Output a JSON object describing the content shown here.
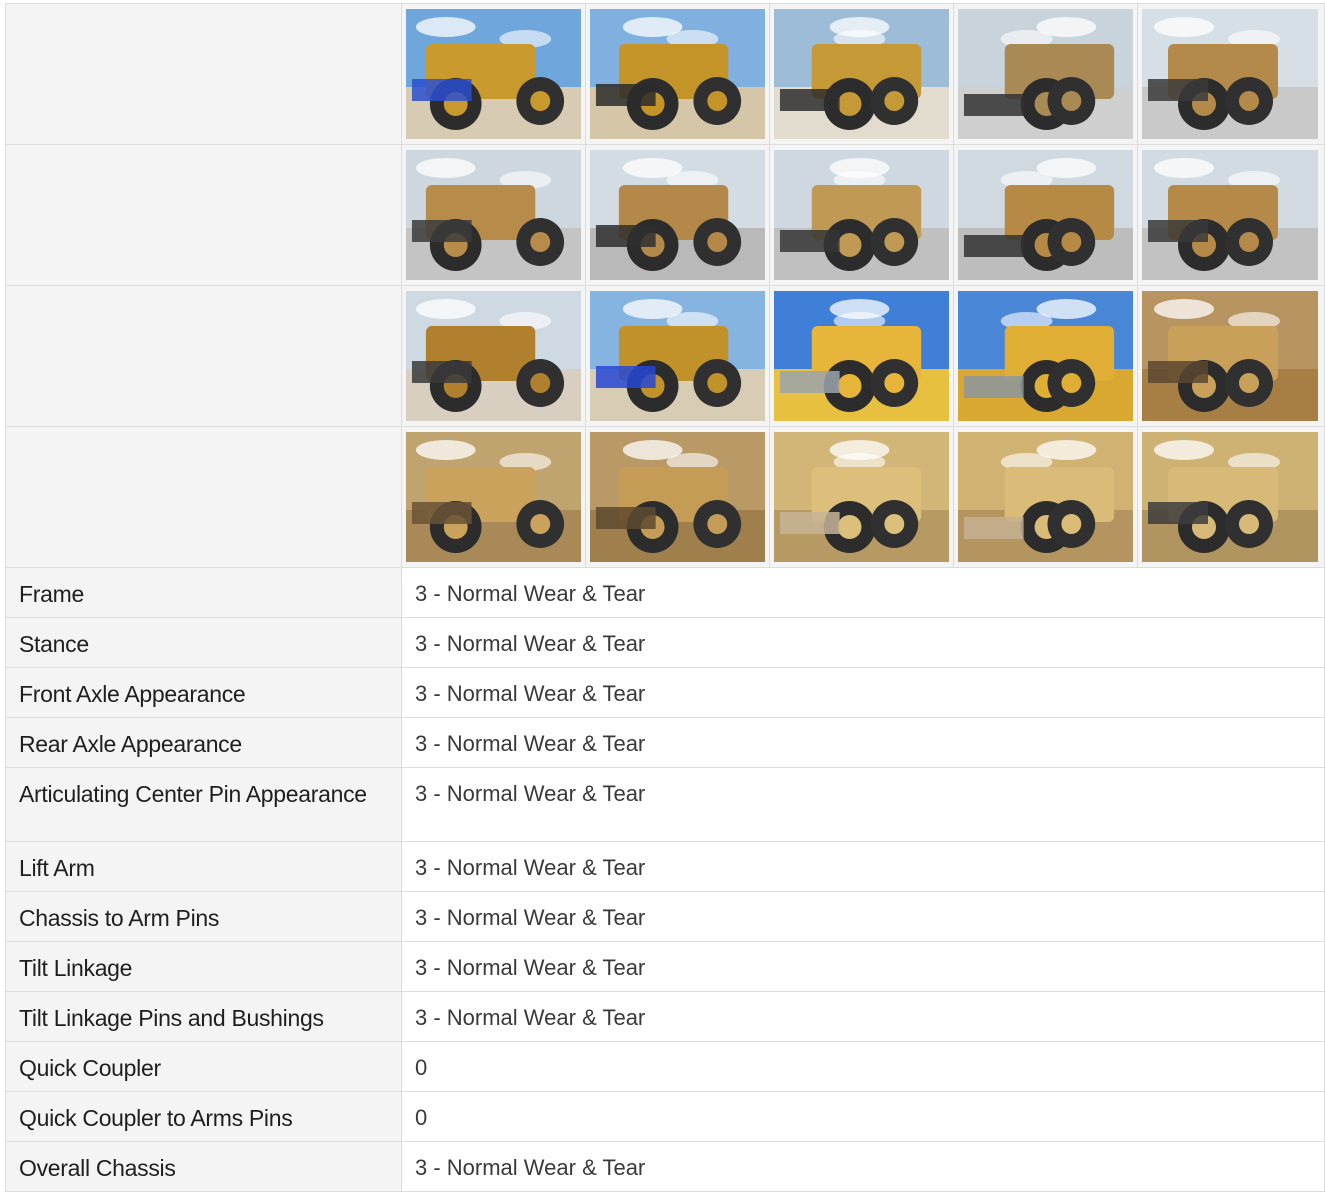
{
  "photo_rows": [
    [
      {
        "name": "photo-loader-front-left",
        "sky": "#6fa6dc",
        "ground": "#d8cbb4",
        "body": "#c89a2e",
        "accent": "#2a4fd0"
      },
      {
        "name": "photo-loader-front-right",
        "sky": "#7fb0df",
        "ground": "#d6c6a8",
        "body": "#c49428",
        "accent": "#2b2b2b"
      },
      {
        "name": "photo-loader-rear",
        "sky": "#9cbcd8",
        "ground": "#e2dccf",
        "body": "#c59a36",
        "accent": "#2e2e2e"
      },
      {
        "name": "photo-underside-axle-1",
        "sky": "#c9d3dc",
        "ground": "#cfcfcf",
        "body": "#a98a55",
        "accent": "#333333"
      },
      {
        "name": "photo-underside-axle-2",
        "sky": "#d6dfe6",
        "ground": "#c9c9c9",
        "body": "#b48a4a",
        "accent": "#3a3a3a"
      }
    ],
    [
      {
        "name": "photo-tire-closeup-1",
        "sky": "#cfd7de",
        "ground": "#c4c4c4",
        "body": "#b78c4a",
        "accent": "#3b3b3b"
      },
      {
        "name": "photo-frame-underside-1",
        "sky": "#d3dce3",
        "ground": "#b9b9b9",
        "body": "#b38848",
        "accent": "#2f2f2f"
      },
      {
        "name": "photo-frame-underside-2",
        "sky": "#cfd8e0",
        "ground": "#c0c0c0",
        "body": "#c09a55",
        "accent": "#353535"
      },
      {
        "name": "photo-tire-closeup-2",
        "sky": "#d0d9e0",
        "ground": "#bdbdbd",
        "body": "#b68a45",
        "accent": "#333333"
      },
      {
        "name": "photo-tire-closeup-3",
        "sky": "#d2dbe2",
        "ground": "#c2c2c2",
        "body": "#b58a48",
        "accent": "#383838"
      }
    ],
    [
      {
        "name": "photo-underside-view",
        "sky": "#cfd9e3",
        "ground": "#d8cfc0",
        "body": "#b0802f",
        "accent": "#3a3a3a"
      },
      {
        "name": "photo-loader-bucket-front",
        "sky": "#86b4e0",
        "ground": "#d9ccb4",
        "body": "#c2922a",
        "accent": "#2648d6"
      },
      {
        "name": "photo-lift-cylinder-1",
        "sky": "#3f7fd8",
        "ground": "#e8c040",
        "body": "#e7b53a",
        "accent": "#9aa3ad"
      },
      {
        "name": "photo-lift-cylinder-2",
        "sky": "#4a86d6",
        "ground": "#d8a830",
        "body": "#e0ad35",
        "accent": "#8d969f"
      },
      {
        "name": "photo-linkage-pin-1",
        "sky": "#b89560",
        "ground": "#a77f45",
        "body": "#c9a05a",
        "accent": "#5a4630"
      }
    ],
    [
      {
        "name": "photo-center-pin-1",
        "sky": "#c0a46f",
        "ground": "#a88957",
        "body": "#caa25b",
        "accent": "#6a5436"
      },
      {
        "name": "photo-center-pin-2",
        "sky": "#b99a66",
        "ground": "#9f7f4c",
        "body": "#c59c55",
        "accent": "#5e4a30"
      },
      {
        "name": "photo-coupler-pin-1",
        "sky": "#d2b678",
        "ground": "#b79a63",
        "body": "#ddbf7c",
        "accent": "#c7b497"
      },
      {
        "name": "photo-coupler-pin-2",
        "sky": "#d0b272",
        "ground": "#b4955f",
        "body": "#dbbb78",
        "accent": "#c4b092"
      },
      {
        "name": "photo-coupler-pin-3",
        "sky": "#cdb274",
        "ground": "#b09560",
        "body": "#d8ba78",
        "accent": "#3d3d3d"
      }
    ]
  ],
  "inspection_rows": [
    {
      "label": "Frame",
      "value": "3 - Normal Wear & Tear"
    },
    {
      "label": "Stance",
      "value": "3 - Normal Wear & Tear"
    },
    {
      "label": "Front Axle Appearance",
      "value": "3 - Normal Wear & Tear"
    },
    {
      "label": "Rear Axle Appearance",
      "value": "3 - Normal Wear & Tear"
    },
    {
      "label": "Articulating Center Pin Appearance",
      "value": "3 - Normal Wear & Tear"
    },
    {
      "label": "Lift Arm",
      "value": "3 - Normal Wear & Tear"
    },
    {
      "label": "Chassis to Arm Pins",
      "value": "3 - Normal Wear & Tear"
    },
    {
      "label": "Tilt Linkage",
      "value": "3 - Normal Wear & Tear"
    },
    {
      "label": "Tilt Linkage Pins and Bushings",
      "value": "3 - Normal Wear & Tear"
    },
    {
      "label": "Quick Coupler",
      "value": "0"
    },
    {
      "label": "Quick Coupler to Arms Pins",
      "value": "0"
    },
    {
      "label": "Overall Chassis",
      "value": "3 - Normal Wear & Tear"
    }
  ]
}
